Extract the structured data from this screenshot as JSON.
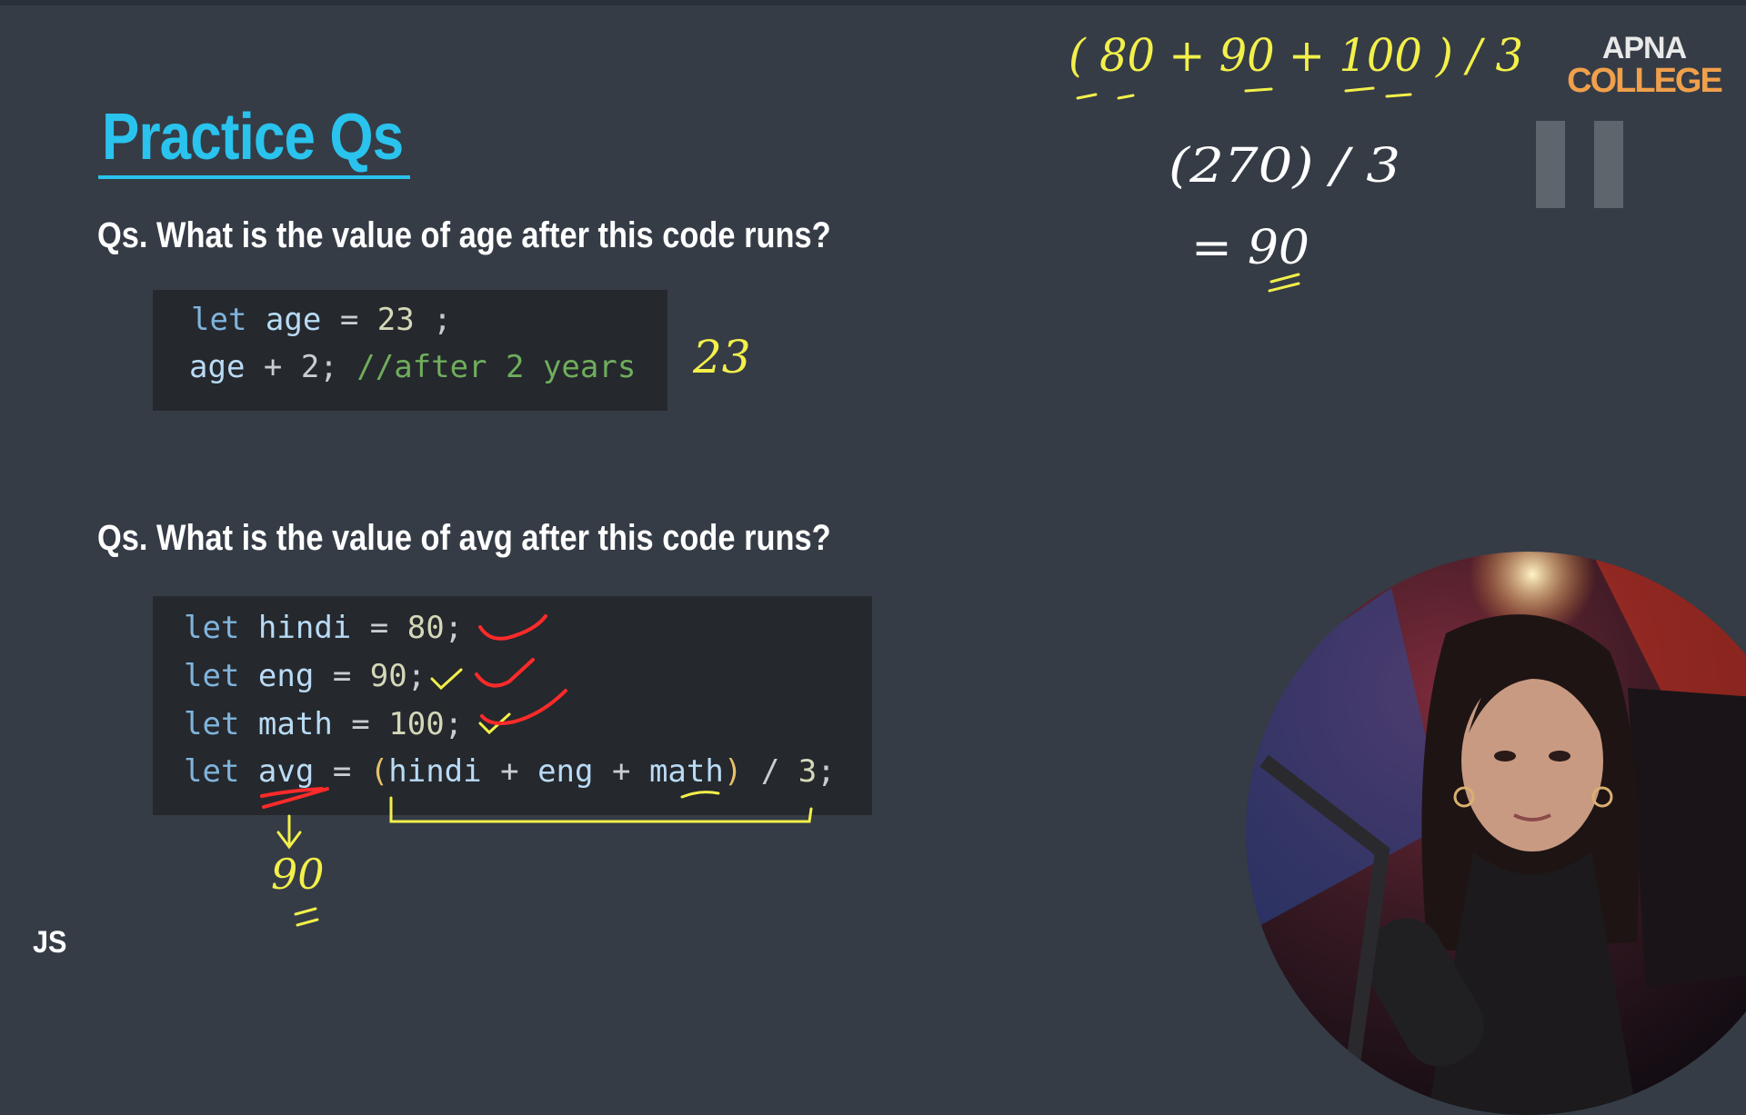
{
  "slide": {
    "title": "Practice Qs",
    "question1": "Qs. What is the value of age after this code runs?",
    "question2": "Qs. What is the value of avg after this code runs?",
    "footer_label": "JS"
  },
  "code1": {
    "line1": {
      "kw": "let",
      "ident": "age",
      "eq": "=",
      "value": "23",
      "semi": ";"
    },
    "line2": {
      "ident": "age",
      "rest": " + 2;",
      "comment": "//after 2 years"
    }
  },
  "code2": {
    "lines": [
      {
        "kw": "let",
        "ident": "hindi",
        "eq": "=",
        "value": "80",
        "semi": ";"
      },
      {
        "kw": "let",
        "ident": "eng",
        "eq": "=",
        "value": "90",
        "semi": ";"
      },
      {
        "kw": "let",
        "ident": "math",
        "eq": "=",
        "value": "100",
        "semi": ";"
      }
    ],
    "avg": {
      "kw": "let",
      "ident": "avg",
      "eq": "=",
      "open": "(",
      "a": "hindi",
      "plus": "+",
      "b": "eng",
      "c": "math",
      "close": ")",
      "div": "/",
      "divisor": "3",
      "semi": ";"
    }
  },
  "annotations": {
    "answer1": "23",
    "work_line1": "( 80 + 90 + 100 ) / 3",
    "work_line2": "(270) / 3",
    "work_line3": "= 90",
    "avg_result": "90"
  },
  "logo": {
    "line1": "APNA",
    "line2": "COLLEGE"
  },
  "colors": {
    "background": "#353c46",
    "title": "#29c3ee",
    "code_bg": "#25282d",
    "handwriting_yellow": "#f3f04a",
    "handwriting_white": "#ffffff",
    "handwriting_red": "#ff2a2a",
    "logo_orange": "#f0a04b"
  },
  "icons": [
    "pause-icon",
    "check-mark-icon"
  ]
}
